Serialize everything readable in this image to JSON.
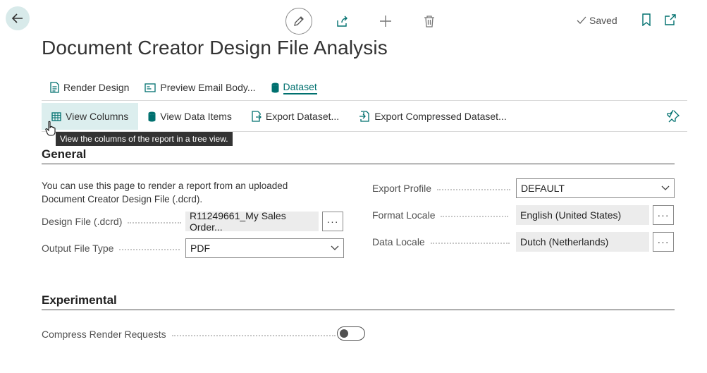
{
  "header": {
    "saved_label": "Saved",
    "title": "Document Creator Design File Analysis"
  },
  "actions_primary": [
    {
      "label": "Render Design",
      "icon": "render-design-icon"
    },
    {
      "label": "Preview Email Body...",
      "icon": "preview-email-icon"
    },
    {
      "label": "Dataset",
      "icon": "dataset-icon",
      "active": true
    }
  ],
  "actions_secondary": [
    {
      "label": "View Columns",
      "icon": "view-columns-icon"
    },
    {
      "label": "View Data Items",
      "icon": "view-data-items-icon"
    },
    {
      "label": "Export Dataset...",
      "icon": "export-dataset-icon"
    },
    {
      "label": "Export Compressed Dataset...",
      "icon": "export-compressed-icon"
    }
  ],
  "tooltip": "View the columns of the report in a tree view.",
  "general": {
    "title": "General",
    "description": "You can use this page to render a report from an uploaded Document Creator Design File (.dcrd).",
    "design_file_label": "Design File (.dcrd)",
    "design_file_value": "R11249661_My Sales Order...",
    "output_type_label": "Output File Type",
    "output_type_value": "PDF",
    "export_profile_label": "Export Profile",
    "export_profile_value": "DEFAULT",
    "format_locale_label": "Format Locale",
    "format_locale_value": "English (United States)",
    "data_locale_label": "Data Locale",
    "data_locale_value": "Dutch (Netherlands)",
    "ellipsis": "···"
  },
  "experimental": {
    "title": "Experimental",
    "compress_label": "Compress Render Requests",
    "compress_on": false
  },
  "colors": {
    "accent": "#00706f",
    "hover_bg": "#dceeee",
    "back_bg": "#d8eaea"
  }
}
